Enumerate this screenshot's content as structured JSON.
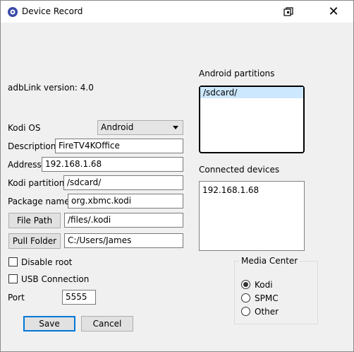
{
  "window": {
    "title": "Device Record"
  },
  "version_text": "adbLink version: 4.0",
  "form": {
    "kodi_os_label": "Kodi OS",
    "kodi_os_value": "Android",
    "description_label": "Description",
    "description_value": "FireTV4KOffice",
    "address_label": "Address",
    "address_value": "192.168.1.68",
    "kodi_partition_label": "Kodi partition",
    "kodi_partition_value": "/sdcard/",
    "package_name_label": "Package name",
    "package_name_value": "org.xbmc.kodi",
    "file_path_button": "File Path",
    "file_path_value": "/files/.kodi",
    "pull_folder_button": "Pull Folder",
    "pull_folder_value": "C:/Users/James",
    "disable_root_label": "Disable root",
    "usb_connection_label": "USB Connection",
    "port_label": "Port",
    "port_value": "5555"
  },
  "android_partitions": {
    "label": "Android partitions",
    "items": [
      "/sdcard/"
    ]
  },
  "connected_devices": {
    "label": "Connected devices",
    "items": [
      "192.168.1.68"
    ]
  },
  "media_center": {
    "label": "Media Center",
    "options": [
      "Kodi",
      "SPMC",
      "Other"
    ],
    "selected": "Kodi"
  },
  "buttons": {
    "save": "Save",
    "cancel": "Cancel"
  },
  "icons": {
    "app": "app-icon",
    "restore": "restore-icon",
    "close": "close-icon"
  }
}
